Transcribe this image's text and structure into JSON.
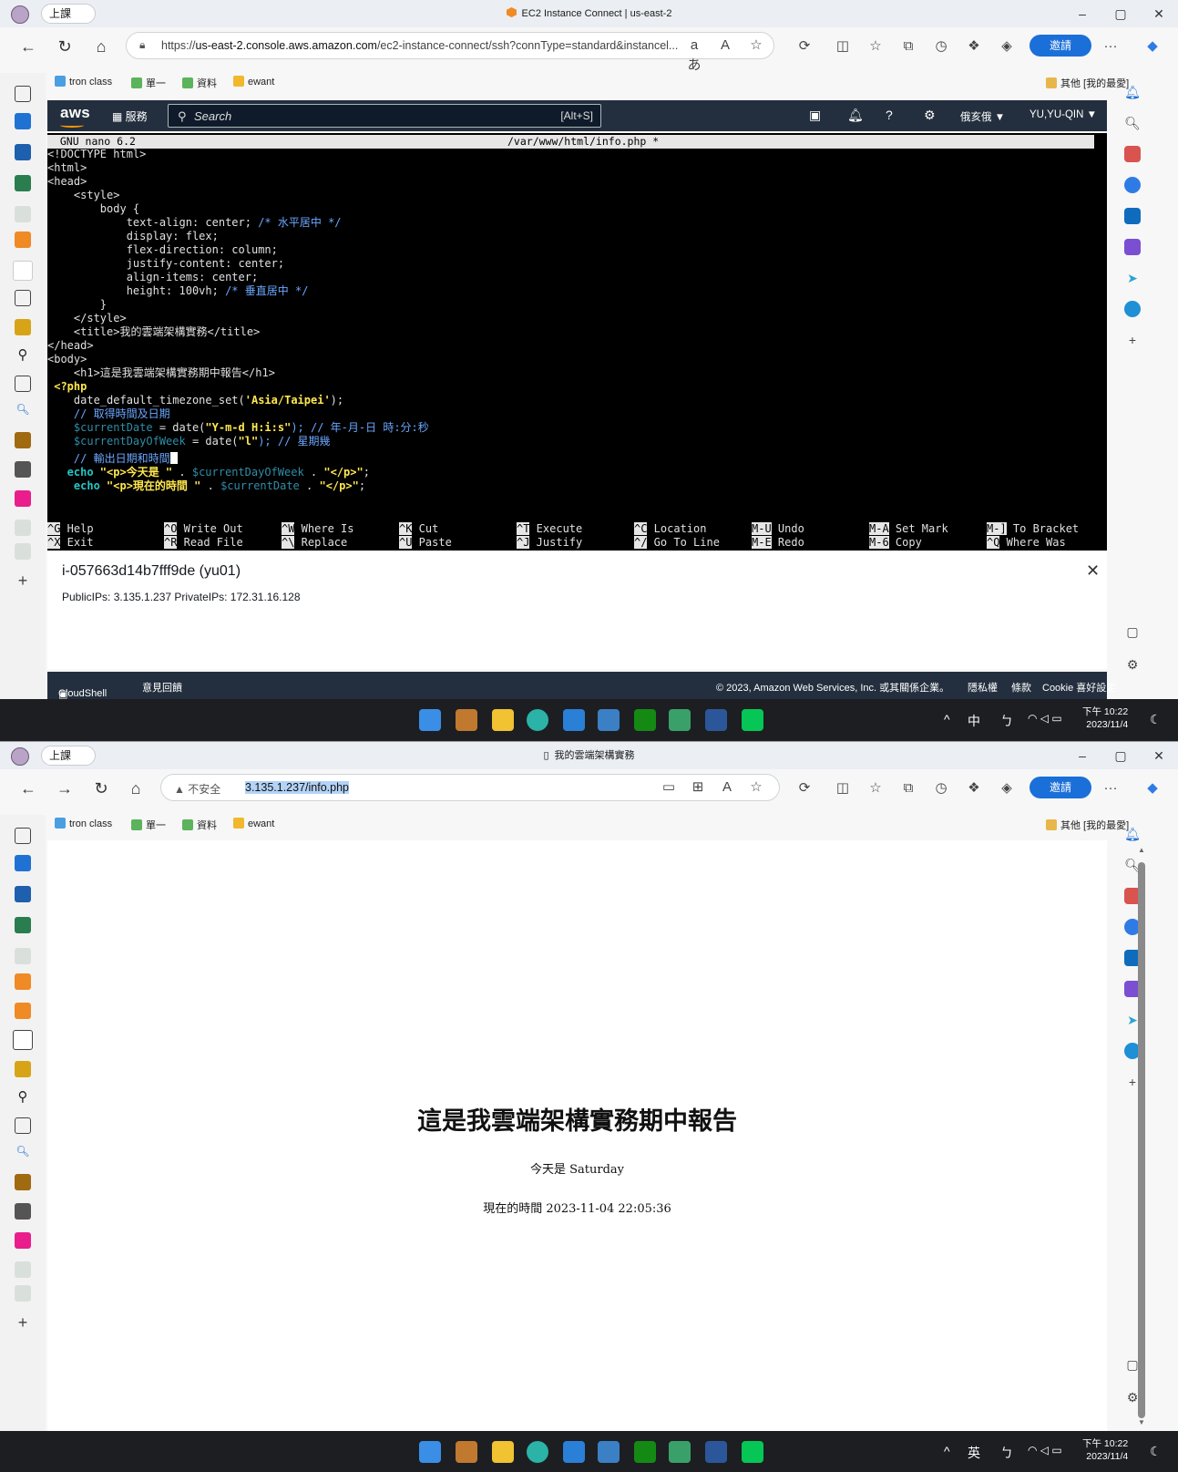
{
  "common": {
    "tab_label": "上課",
    "bookmarks": [
      "tron class",
      "單一",
      "資料",
      "ewant"
    ],
    "bookmarks_other": "其他 [我的最愛]",
    "invite_label": "邀請",
    "more_label": "···"
  },
  "window1": {
    "title": "EC2 Instance Connect | us-east-2",
    "url_prefix": "https://",
    "url_host": "us-east-2.console.aws.amazon.com",
    "url_path": "/ec2-instance-connect/ssh?connType=standard&instancel...",
    "aws": {
      "services_label": "服務",
      "search_placeholder": "Search",
      "search_shortcut": "[Alt+S]",
      "region": "俄亥俄 ▼",
      "user": "YU,YU-QIN ▼"
    },
    "terminal": {
      "nano_header_left": "  GNU nano 6.2",
      "nano_header_file": "/var/www/html/info.php *",
      "lines": [
        "<!DOCTYPE html>",
        "<html>",
        "<head>",
        "    <style>",
        "        body {",
        "            text-align: center; ",
        "/* 水平居中 */",
        "            display: flex;",
        "            flex-direction: column;",
        "            justify-content: center;",
        "            align-items: center;",
        "            height: 100vh; ",
        "/* 垂直居中 */",
        "        }",
        "    </style>",
        "    <title>我的雲端架構實務</title>",
        "</head>",
        "<body>",
        "    <h1>這是我雲端架構實務期中報告</h1>",
        " <?php",
        "    date_default_timezone_set(",
        "'Asia/Taipei'",
        ");",
        "    // 取得時間及日期",
        "    $currentDate",
        " = date(",
        "\"Y-m-d H:i:s\"",
        "); // 年-月-日 時:分:秒",
        "    $currentDayOfWeek",
        " = date(",
        "\"l\"",
        "); // 星期幾",
        "    // 輸出日期和時間",
        "   echo ",
        "\"<p>今天是 \"",
        " . ",
        "$currentDayOfWeek",
        " . ",
        "\"</p>\"",
        ";",
        "    echo ",
        "\"<p>現在的時間 \"",
        " . ",
        "$currentDate",
        " . ",
        "\"</p>\"",
        ";"
      ],
      "shortcuts": [
        {
          "key": "^G",
          "label": " Help"
        },
        {
          "key": "^X",
          "label": " Exit"
        },
        {
          "key": "^O",
          "label": " Write Out"
        },
        {
          "key": "^R",
          "label": " Read File"
        },
        {
          "key": "^W",
          "label": " Where Is"
        },
        {
          "key": "^\\",
          "label": " Replace"
        },
        {
          "key": "^K",
          "label": " Cut"
        },
        {
          "key": "^U",
          "label": " Paste"
        },
        {
          "key": "^T",
          "label": " Execute"
        },
        {
          "key": "^J",
          "label": " Justify"
        },
        {
          "key": "^C",
          "label": " Location"
        },
        {
          "key": "^/",
          "label": " Go To Line"
        },
        {
          "key": "M-U",
          "label": " Undo"
        },
        {
          "key": "M-E",
          "label": " Redo"
        },
        {
          "key": "M-A",
          "label": " Set Mark"
        },
        {
          "key": "M-6",
          "label": " Copy"
        },
        {
          "key": "M-]",
          "label": " To Bracket"
        },
        {
          "key": "^Q",
          "label": " Where Was"
        }
      ]
    },
    "instance": {
      "id": "i-057663d14b7fff9de (yu01)",
      "ips": "PublicIPs: 3.135.1.237   PrivateIPs: 172.31.16.128"
    },
    "footer": {
      "cloudshell": "CloudShell",
      "feedback": "意見回饋",
      "copyright": "© 2023, Amazon Web Services, Inc. 或其關係企業。",
      "privacy": "隱私權",
      "terms": "條款",
      "cookie": "Cookie 喜好設定"
    },
    "taskbar": {
      "ime1": "中",
      "ime2": "ㄅ",
      "time": "下午 10:22",
      "date": "2023/11/4"
    }
  },
  "window2": {
    "title": "我的雲端架構實務",
    "insecure_label": "不安全",
    "url": "3.135.1.237/info.php",
    "page": {
      "h1": "這是我雲端架構實務期中報告",
      "p1": "今天是 Saturday",
      "p2": "現在的時間 2023-11-04 22:05:36"
    },
    "taskbar": {
      "ime1": "英",
      "ime2": "ㄅ",
      "time": "下午 10:22",
      "date": "2023/11/4"
    }
  },
  "colors": {
    "aws_navy": "#232f3e",
    "aws_orange": "#ff9900",
    "edge_blue": "#1b6fd8"
  }
}
